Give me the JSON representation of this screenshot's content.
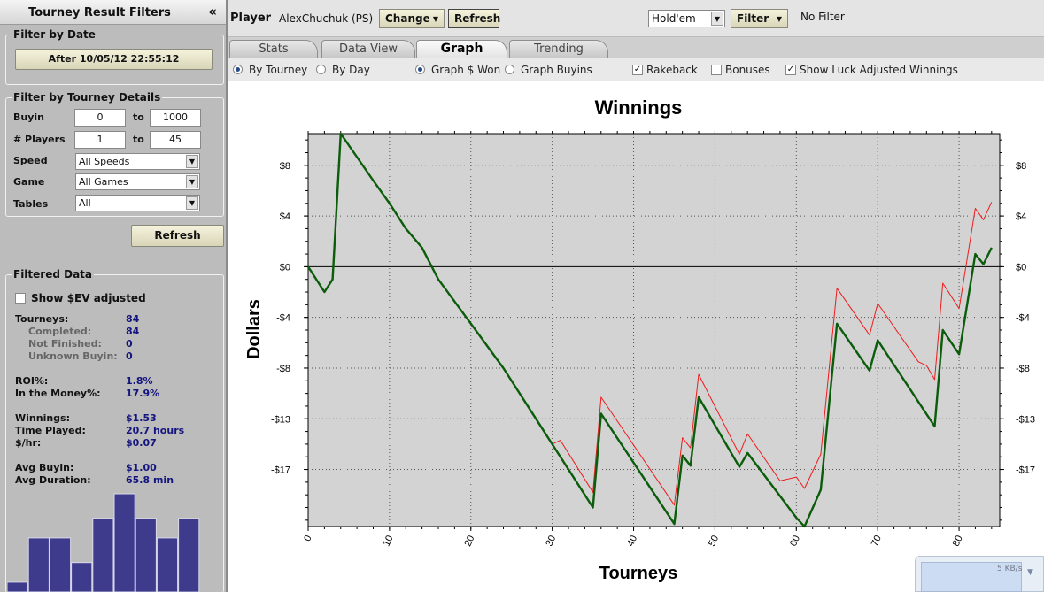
{
  "sidebar": {
    "title": "Tourney Result Filters",
    "collapse_icon": "«",
    "date_group": {
      "label": "Filter by Date",
      "button": "After 10/05/12 22:55:12"
    },
    "details_group": {
      "label": "Filter by Tourney Details",
      "buyin_label": "Buyin",
      "buyin_min": "0",
      "buyin_max": "1000",
      "players_label": "# Players",
      "players_min": "1",
      "players_max": "45",
      "to": "to",
      "speed_label": "Speed",
      "speed_value": "All Speeds",
      "game_label": "Game",
      "game_value": "All Games",
      "tables_label": "Tables",
      "tables_value": "All"
    },
    "refresh": "Refresh",
    "filtered": {
      "label": "Filtered Data",
      "ev_checkbox": "Show $EV adjusted",
      "stats": [
        {
          "label": "Tourneys:",
          "value": "84",
          "sub": false
        },
        {
          "label": "Completed:",
          "value": "84",
          "sub": true
        },
        {
          "label": "Not Finished:",
          "value": "0",
          "sub": true
        },
        {
          "label": "Unknown Buyin:",
          "value": "0",
          "sub": true
        },
        {
          "label": "ROI%:",
          "value": "1.8%",
          "sub": false
        },
        {
          "label": "In the Money%:",
          "value": "17.9%",
          "sub": false
        },
        {
          "label": "Winnings:",
          "value": "$1.53",
          "sub": false
        },
        {
          "label": "Time Played:",
          "value": "20.7 hours",
          "sub": false
        },
        {
          "label": "$/hr:",
          "value": "$0.07",
          "sub": false
        },
        {
          "label": "Avg Buyin:",
          "value": "$1.00",
          "sub": false
        },
        {
          "label": "Avg Duration:",
          "value": "65.8 min",
          "sub": false
        }
      ]
    },
    "histogram": {
      "color": "#3e3a8c",
      "values": [
        0.1,
        0.55,
        0.55,
        0.3,
        0.75,
        1.0,
        0.75,
        0.55,
        0.75
      ]
    }
  },
  "topbar": {
    "player_label": "Player",
    "player_name": "AlexChuchuk (PS)",
    "change": "Change",
    "refresh": "Refresh",
    "game_select": "Hold'em",
    "filter": "Filter",
    "filter_status": "No Filter"
  },
  "tabs": [
    {
      "label": "Stats",
      "active": false
    },
    {
      "label": "Data View",
      "active": false
    },
    {
      "label": "Graph",
      "active": true
    },
    {
      "label": "Trending",
      "active": false
    }
  ],
  "options": {
    "by_tourney": "By Tourney",
    "by_day": "By Day",
    "graph_won": "Graph $ Won",
    "graph_buyins": "Graph Buyins",
    "rakeback": "Rakeback",
    "bonuses": "Bonuses",
    "luck_adjusted": "Show Luck Adjusted Winnings"
  },
  "tray": {
    "speed": "5 KB/s"
  },
  "chart_data": {
    "type": "line",
    "title": "Winnings",
    "xlabel": "Tourneys",
    "ylabel": "Dollars",
    "xlim": [
      0,
      85
    ],
    "ylim": [
      -20.5,
      10.5
    ],
    "x_ticks": [
      0,
      10,
      20,
      30,
      40,
      50,
      60,
      70,
      80
    ],
    "y_ticks": [
      8,
      4,
      0,
      -4,
      -8,
      -12,
      -16
    ],
    "y_tick_labels": [
      "$8",
      "$4",
      "$0",
      "-$4",
      "-$8",
      "-$13",
      "-$17"
    ],
    "grid": true,
    "background": "#d3d3d3",
    "series": [
      {
        "color": "#ee1c1c",
        "points": [
          [
            0,
            0
          ],
          [
            2,
            -2
          ],
          [
            3,
            -1
          ],
          [
            4,
            10.5
          ],
          [
            8,
            6.8
          ],
          [
            10,
            5
          ],
          [
            12,
            3
          ],
          [
            14,
            1.5
          ],
          [
            16,
            -1
          ],
          [
            20,
            -4.5
          ],
          [
            24,
            -8
          ],
          [
            28,
            -12
          ],
          [
            30,
            -14
          ],
          [
            31,
            -13.7
          ],
          [
            35,
            -17.8
          ],
          [
            36,
            -10.3
          ],
          [
            45,
            -18.8
          ],
          [
            46,
            -13.5
          ],
          [
            47,
            -14.3
          ],
          [
            48,
            -8.5
          ],
          [
            53,
            -14.8
          ],
          [
            54,
            -13.2
          ],
          [
            58,
            -16.9
          ],
          [
            60,
            -16.6
          ],
          [
            61,
            -17.5
          ],
          [
            63,
            -14.8
          ],
          [
            65,
            -1.7
          ],
          [
            69,
            -5.4
          ],
          [
            70,
            -2.9
          ],
          [
            75,
            -7.5
          ],
          [
            76,
            -7.8
          ],
          [
            77,
            -8.9
          ],
          [
            78,
            -1.3
          ],
          [
            80,
            -3.3
          ],
          [
            82,
            4.6
          ],
          [
            83,
            3.7
          ],
          [
            84,
            5.1
          ]
        ]
      },
      {
        "color": "#0b5c0b",
        "points": [
          [
            0,
            0
          ],
          [
            2,
            -2
          ],
          [
            3,
            -1
          ],
          [
            4,
            10.5
          ],
          [
            8,
            6.8
          ],
          [
            10,
            5
          ],
          [
            12,
            3
          ],
          [
            14,
            1.5
          ],
          [
            16,
            -1
          ],
          [
            20,
            -4.5
          ],
          [
            24,
            -8
          ],
          [
            28,
            -12
          ],
          [
            30,
            -14
          ],
          [
            35,
            -19
          ],
          [
            36,
            -11.6
          ],
          [
            45,
            -20.3
          ],
          [
            46,
            -14.9
          ],
          [
            47,
            -15.7
          ],
          [
            48,
            -10.3
          ],
          [
            53,
            -15.8
          ],
          [
            54,
            -14.7
          ],
          [
            60,
            -19.8
          ],
          [
            61,
            -20.5
          ],
          [
            63,
            -17.6
          ],
          [
            65,
            -4.5
          ],
          [
            69,
            -8.2
          ],
          [
            70,
            -5.8
          ],
          [
            77,
            -12.6
          ],
          [
            78,
            -5
          ],
          [
            80,
            -6.9
          ],
          [
            82,
            1
          ],
          [
            83,
            0.2
          ],
          [
            84,
            1.5
          ]
        ]
      }
    ]
  }
}
